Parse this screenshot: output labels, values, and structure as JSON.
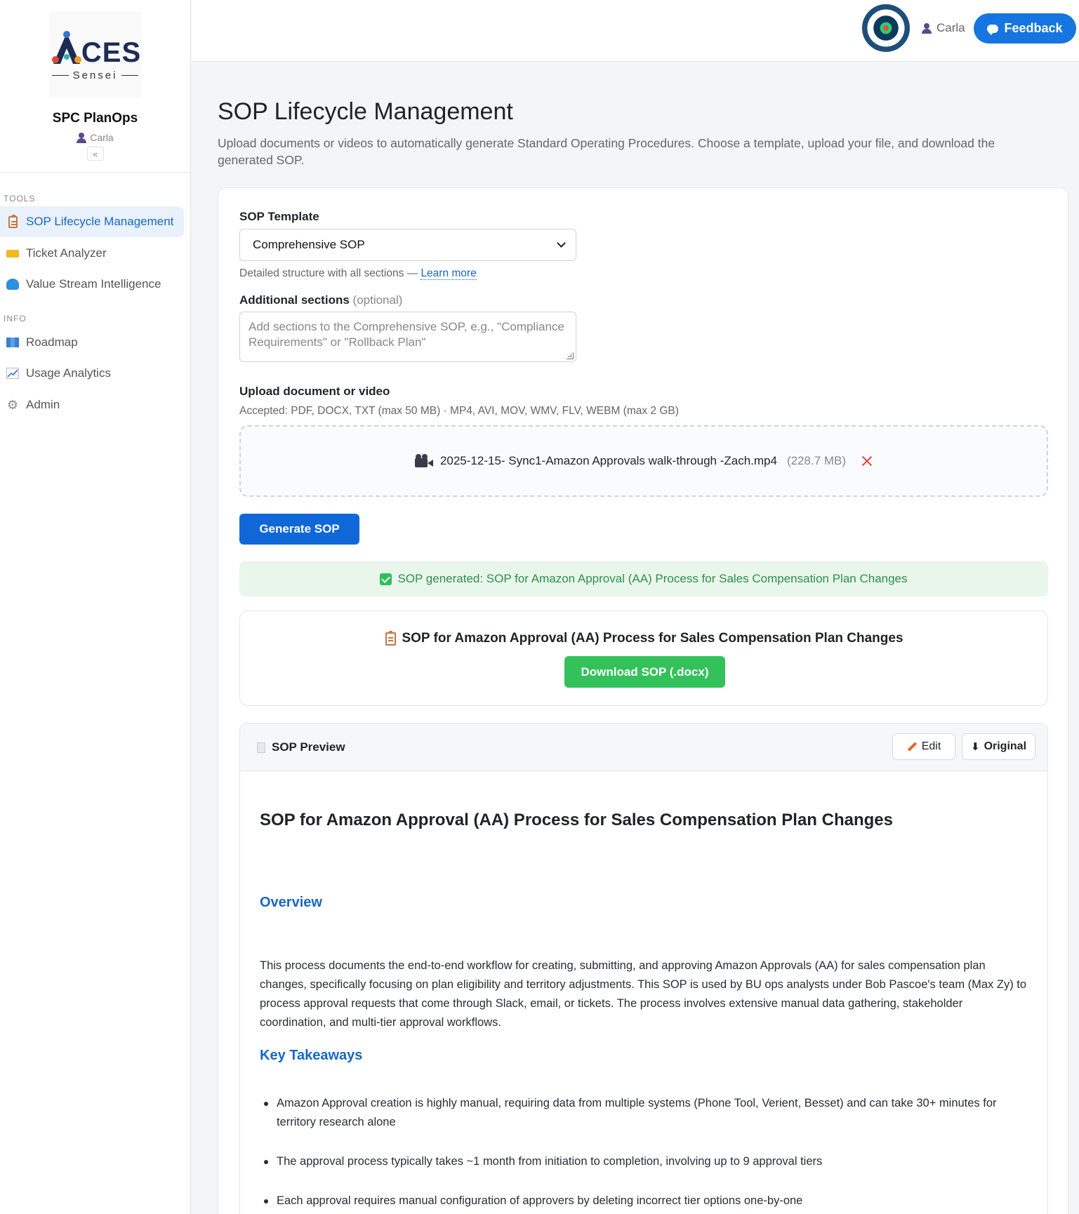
{
  "sidebar": {
    "logo_text": "CES",
    "logo_sub": "Sensei",
    "app_title": "SPC PlanOps",
    "user_name": "Carla",
    "collapse_label": "«",
    "sections": [
      {
        "label": "TOOLS"
      },
      {
        "label": "INFO"
      }
    ],
    "items": [
      {
        "label": "SOP Lifecycle Management",
        "icon": "clipboard-icon",
        "active": true
      },
      {
        "label": "Ticket Analyzer",
        "icon": "ticket-icon"
      },
      {
        "label": "Value Stream Intelligence",
        "icon": "wave-icon"
      },
      {
        "label": "Roadmap",
        "icon": "map-icon"
      },
      {
        "label": "Usage Analytics",
        "icon": "chart-icon"
      },
      {
        "label": "Admin",
        "icon": "gear-icon"
      }
    ]
  },
  "topbar": {
    "badge_icon": "process-engineering-team-badge",
    "user_name": "Carla",
    "feedback_label": "Feedback"
  },
  "page": {
    "title": "SOP Lifecycle Management",
    "description": "Upload documents or videos to automatically generate Standard Operating Procedures. Choose a template, upload your file, and download the generated SOP."
  },
  "form": {
    "template_label": "SOP Template",
    "template_value": "Comprehensive SOP",
    "template_help": "Detailed structure with all sections — ",
    "learn_more": "Learn more",
    "additional_label": "Additional sections",
    "additional_optional": "(optional)",
    "additional_placeholder": "Add sections to the Comprehensive SOP, e.g., \"Compliance Requirements\" or \"Rollback Plan\"",
    "upload_label": "Upload document or video",
    "accepted": "Accepted: PDF, DOCX, TXT (max 50 MB) · MP4, AVI, MOV, WMV, FLV, WEBM (max 2 GB)",
    "file_name": "2025-12-15- Sync1-Amazon Approvals walk-through -Zach.mp4",
    "file_size": "(228.7 MB)",
    "generate_label": "Generate SOP"
  },
  "result": {
    "success_message": "SOP generated: SOP for Amazon Approval (AA) Process for Sales Compensation Plan Changes",
    "title": "SOP for Amazon Approval (AA) Process for Sales Compensation Plan Changes",
    "download_label": "Download SOP (.docx)"
  },
  "preview": {
    "header": "SOP Preview",
    "edit_label": "Edit",
    "original_label": "Original",
    "doc_title": "SOP for Amazon Approval (AA) Process for Sales Compensation Plan Changes",
    "overview_heading": "Overview",
    "overview_text": "This process documents the end-to-end workflow for creating, submitting, and approving Amazon Approvals (AA) for sales compensation plan changes, specifically focusing on plan eligibility and territory adjustments. This SOP is used by BU ops analysts under Bob Pascoe's team (Max Zy) to process approval requests that come through Slack, email, or tickets. The process involves extensive manual data gathering, stakeholder coordination, and multi-tier approval workflows.",
    "takeaways_heading": "Key Takeaways",
    "takeaways": [
      "Amazon Approval creation is highly manual, requiring data from multiple systems (Phone Tool, Verient, Besset) and can take 30+ minutes for territory research alone",
      "The approval process typically takes ~1 month from initiation to completion, involving up to 9 approval tiers",
      "Each approval requires manual configuration of approvers by deleting incorrect tier options one-by-one"
    ]
  }
}
